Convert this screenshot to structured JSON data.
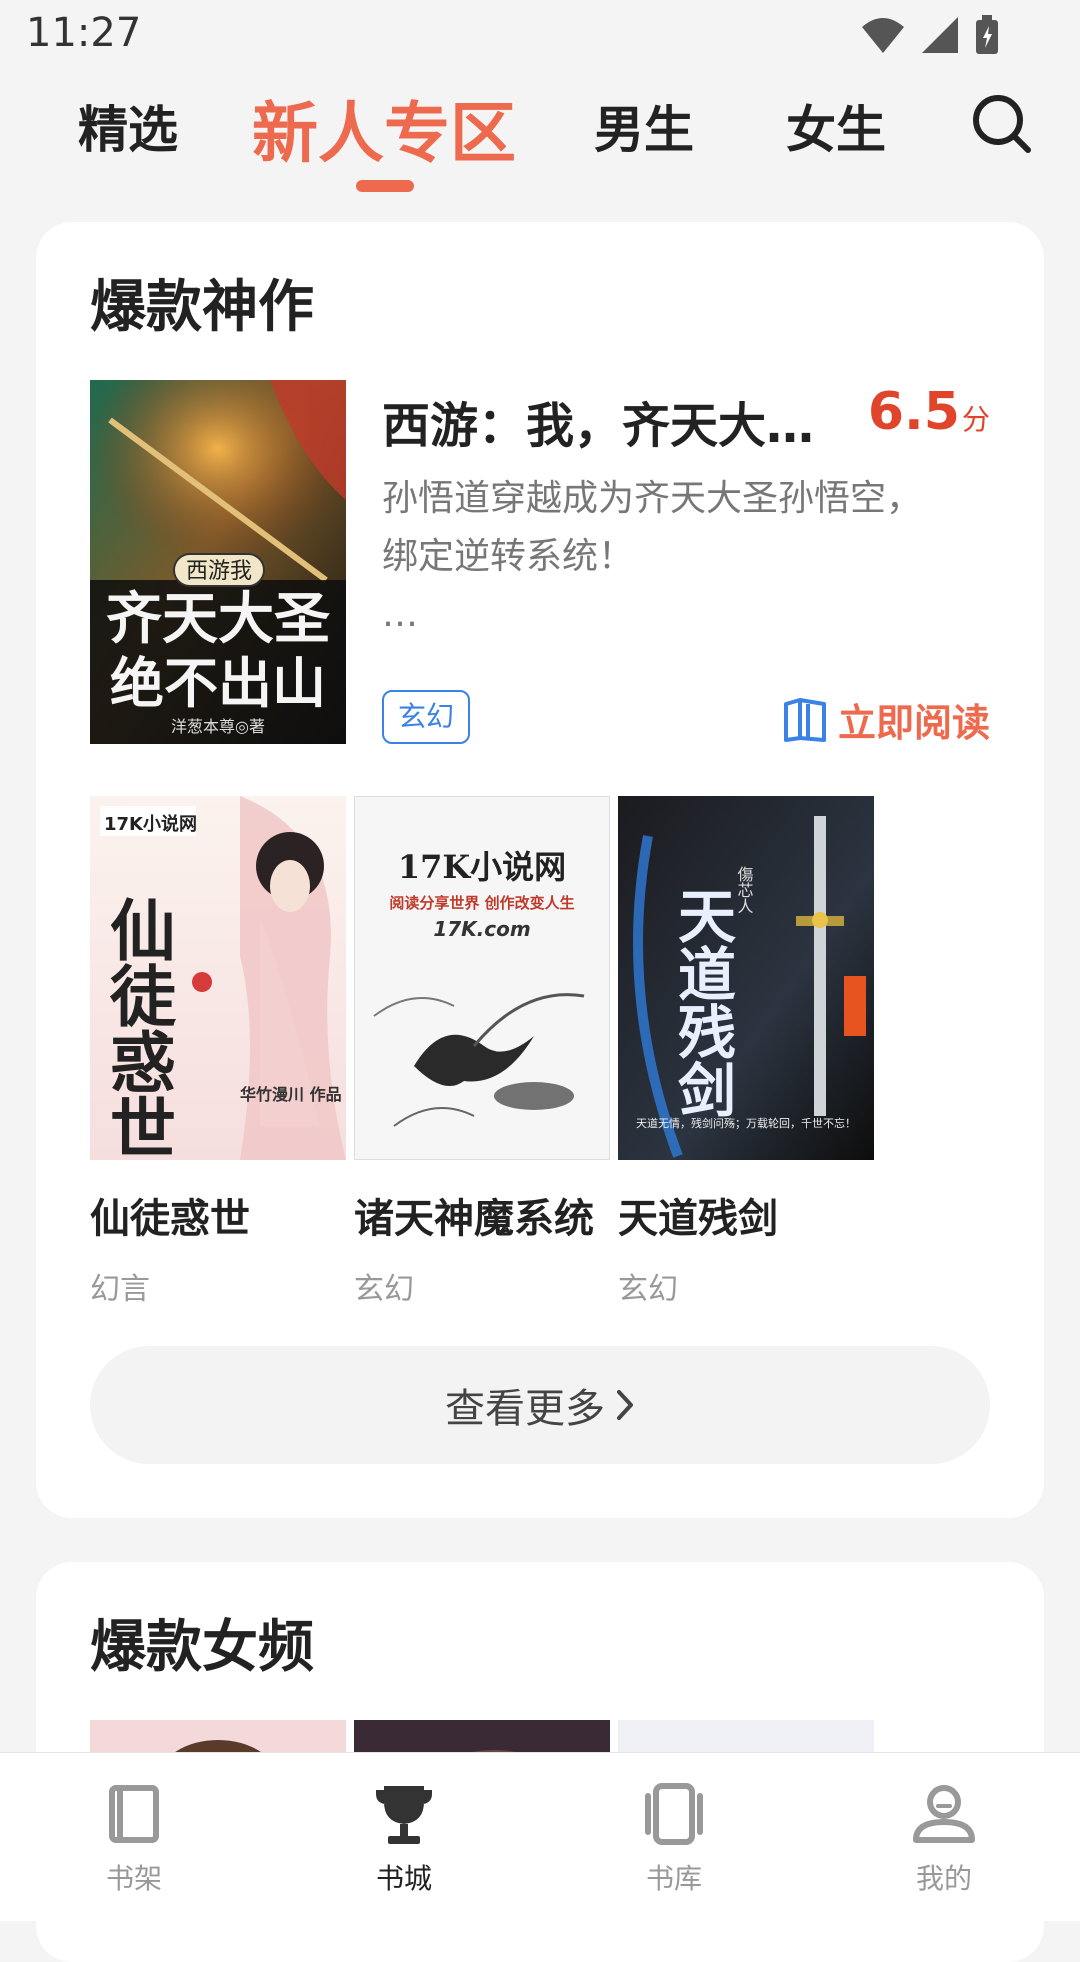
{
  "status_bar": {
    "time": "11:27"
  },
  "top_tabs": {
    "items": [
      {
        "label": "精选"
      },
      {
        "label": "新人专区"
      },
      {
        "label": "男生"
      },
      {
        "label": "女生"
      }
    ],
    "active": "新人专区",
    "accent_color": "#ee6a4e"
  },
  "hot_section": {
    "title": "爆款神作",
    "featured": {
      "title": "西游：我，齐天大…",
      "score": "6.5",
      "score_unit": "分",
      "description_line1": "孙悟道穿越成为齐天大圣孙悟空，",
      "description_line2": "绑定逆转系统！",
      "description_more": "…",
      "tag": "玄幻",
      "read_label": "立即阅读",
      "cover_text_top": "西游我",
      "cover_text_main": "齐天大圣",
      "cover_text_sub": "绝不出山",
      "cover_author": "洋葱本尊◎著"
    },
    "books": [
      {
        "title": "仙徒惑世",
        "genre": "幻言",
        "cover_text": "仙徒惑世",
        "cover_brand": "17K小说网",
        "cover_author": "华竹漫川 作品"
      },
      {
        "title": "诸天神魔系统",
        "genre": "玄幻",
        "cover_text": "17K小说网",
        "cover_slogan": "阅读分享世界 创作改变人生",
        "cover_brand": "17K.com"
      },
      {
        "title": "天道残剑",
        "genre": "玄幻",
        "cover_text": "天道残剑",
        "cover_author": "傷芯人",
        "cover_tagline": "天道无情，残剑问殇；万载轮回，千世不忘！"
      }
    ],
    "more_label": "查看更多"
  },
  "female_section": {
    "title": "爆款女频"
  },
  "bottom_nav": {
    "items": [
      {
        "label": "书架"
      },
      {
        "label": "书城"
      },
      {
        "label": "书库"
      },
      {
        "label": "我的"
      }
    ],
    "active": "书城"
  }
}
